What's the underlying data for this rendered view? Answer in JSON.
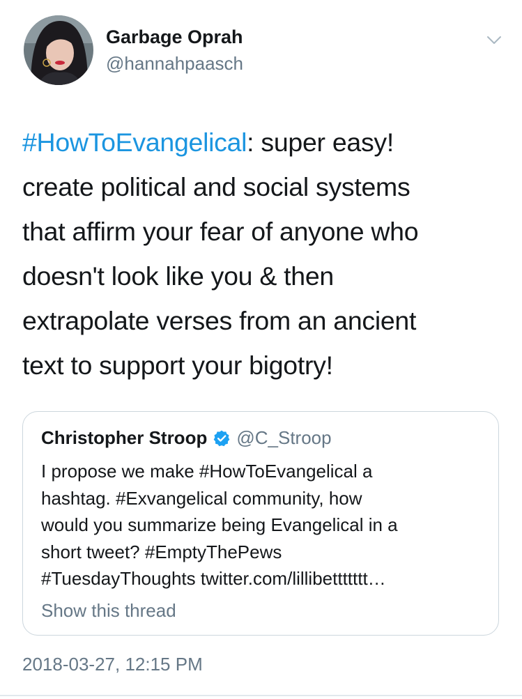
{
  "author": {
    "name": "Garbage Oprah",
    "handle": "@hannahpaasch",
    "avatar_icon": "profile-photo"
  },
  "menu_icon": "chevron-down-icon",
  "tweet": {
    "hashtag": "#HowToEvangelical",
    "lines": [
      ": super easy!",
      "create political and social systems",
      "that affirm your fear of anyone who",
      "doesn't look like you & then",
      "extrapolate verses from an ancient",
      "text to support your bigotry!"
    ]
  },
  "quoted_tweet": {
    "name": "Christopher Stroop",
    "verified_icon": "verified-badge-icon",
    "handle": "@C_Stroop",
    "lines": [
      "I propose we make #HowToEvangelical a",
      "hashtag. #Exvangelical community, how",
      "would you summarize being Evangelical in a",
      "short tweet? #EmptyThePews",
      "#TuesdayThoughts twitter.com/lillibettttttt…"
    ],
    "show_thread": "Show this thread"
  },
  "timestamp": "2018-03-27, 12:15 PM",
  "colors": {
    "text": "#14171a",
    "secondary": "#657786",
    "link": "#1b95e0",
    "verified": "#1da1f2",
    "border": "#ccd6dd"
  }
}
